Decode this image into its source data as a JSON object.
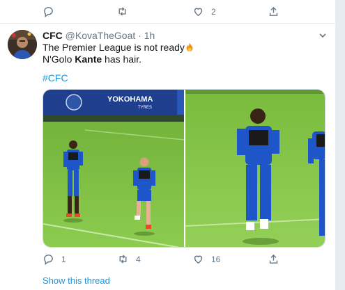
{
  "top_actions": {
    "reply_count": "",
    "retweet_count": "",
    "like_count": "2"
  },
  "tweet": {
    "display_name": "CFC",
    "handle": "@KovaTheGoat",
    "separator": " · ",
    "time": "1h",
    "line1": "The Premier League is not ready",
    "line2_pre": "N'Golo ",
    "line2_bold": "Kante",
    "line2_post": " has hair.",
    "hashtag": "#CFC",
    "sponsor_text": "YOKOHAMA",
    "sponsor_sub": "TYRES"
  },
  "actions": {
    "reply_count": "1",
    "retweet_count": "4",
    "like_count": "16"
  },
  "show_thread": "Show this thread",
  "icons": {
    "reply": "reply-icon",
    "retweet": "retweet-icon",
    "like": "heart-icon",
    "share": "share-icon",
    "caret": "chevron-down-icon",
    "emoji": "fire-emoji-icon"
  },
  "colors": {
    "link": "#1b95e0",
    "muted": "#657786",
    "pitch": "#7ec23f",
    "kit": "#1e55c8"
  }
}
